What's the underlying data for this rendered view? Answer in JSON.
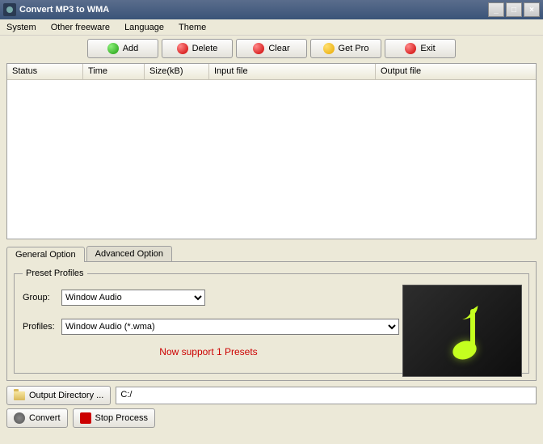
{
  "window": {
    "title": "Convert MP3 to WMA"
  },
  "menu": {
    "system": "System",
    "freeware": "Other freeware",
    "language": "Language",
    "theme": "Theme"
  },
  "toolbar": {
    "add": "Add",
    "delete": "Delete",
    "clear": "Clear",
    "getpro": "Get Pro",
    "exit": "Exit"
  },
  "columns": {
    "status": "Status",
    "time": "Time",
    "size": "Size(kB)",
    "input": "Input file",
    "output": "Output file"
  },
  "tabs": {
    "general": "General Option",
    "advanced": "Advanced Option"
  },
  "preset": {
    "legend": "Preset Profiles",
    "group_label": "Group:",
    "group_value": "Window Audio",
    "profiles_label": "Profiles:",
    "profiles_value": "Window Audio (*.wma)",
    "support_msg": "Now support 1 Presets"
  },
  "output": {
    "button": "Output Directory ...",
    "path": "C:/"
  },
  "actions": {
    "convert": "Convert",
    "stop": "Stop Process"
  }
}
